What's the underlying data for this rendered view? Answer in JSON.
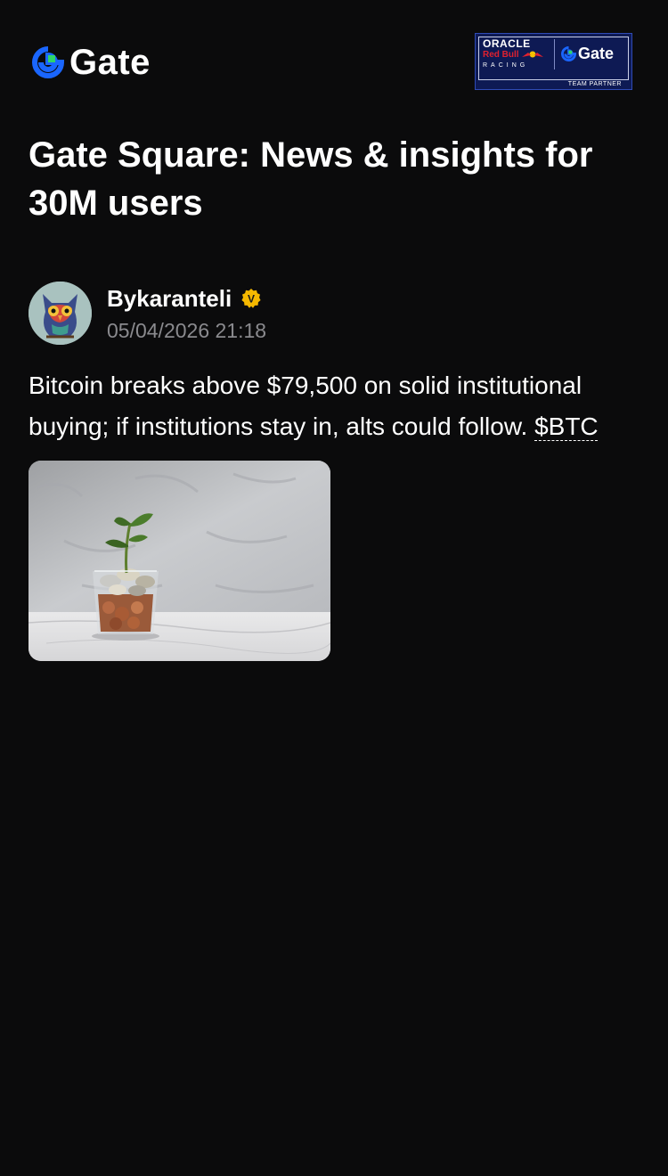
{
  "header": {
    "logo_text": "Gate",
    "partner": {
      "oracle": "ORACLE",
      "red_bull": "Red Bull",
      "racing": "RACING",
      "brand": "Gate",
      "team_partner": "TEAM PARTNER"
    }
  },
  "hero": {
    "title": "Gate Square: News & insights for 30M users"
  },
  "post": {
    "author": {
      "name": "Bykaranteli",
      "verified_badge": "V"
    },
    "timestamp": "05/04/2026 21:18",
    "body_text": "Bitcoin breaks above $79,500 on solid institutional buying; if institutions stay in, alts could follow. ",
    "ticker": "$BTC",
    "image_icon": "coin-jar-plant-photo"
  },
  "colors": {
    "background": "#0b0b0c",
    "text_primary": "#ffffff",
    "text_muted": "#8a8a8e",
    "brand_blue": "#1a66ff",
    "brand_green": "#2fd567",
    "verified_gold": "#f5b800",
    "badge_navy": "#0e1a54"
  }
}
